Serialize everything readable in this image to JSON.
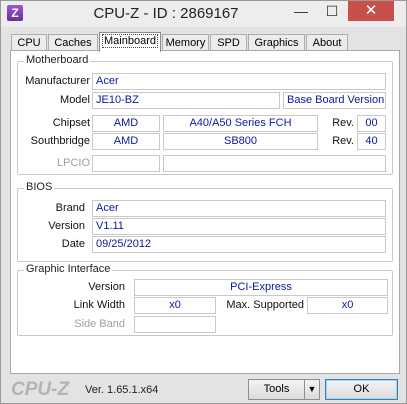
{
  "window": {
    "title": "CPU-Z - ID : 2869167",
    "app_icon_letter": "Z"
  },
  "tabs": [
    "CPU",
    "Caches",
    "Mainboard",
    "Memory",
    "SPD",
    "Graphics",
    "About"
  ],
  "active_tab": "Mainboard",
  "motherboard": {
    "title": "Motherboard",
    "manufacturer_label": "Manufacturer",
    "manufacturer": "Acer",
    "model_label": "Model",
    "model": "JE10-BZ",
    "model_extra": "Base Board Version",
    "chipset_label": "Chipset",
    "chipset_vendor": "AMD",
    "chipset_model": "A40/A50 Series FCH",
    "chipset_rev_label": "Rev.",
    "chipset_rev": "00",
    "southbridge_label": "Southbridge",
    "southbridge_vendor": "AMD",
    "southbridge_model": "SB800",
    "southbridge_rev_label": "Rev.",
    "southbridge_rev": "40",
    "lpcio_label": "LPCIO"
  },
  "bios": {
    "title": "BIOS",
    "brand_label": "Brand",
    "brand": "Acer",
    "version_label": "Version",
    "version": "V1.11",
    "date_label": "Date",
    "date": "09/25/2012"
  },
  "graphic_interface": {
    "title": "Graphic Interface",
    "version_label": "Version",
    "version": "PCI-Express",
    "link_width_label": "Link Width",
    "link_width": "x0",
    "max_supported_label": "Max. Supported",
    "max_supported": "x0",
    "side_band_label": "Side Band"
  },
  "footer": {
    "logo": "CPU-Z",
    "version": "Ver. 1.65.1.x64",
    "tools_label": "Tools",
    "ok_label": "OK"
  }
}
